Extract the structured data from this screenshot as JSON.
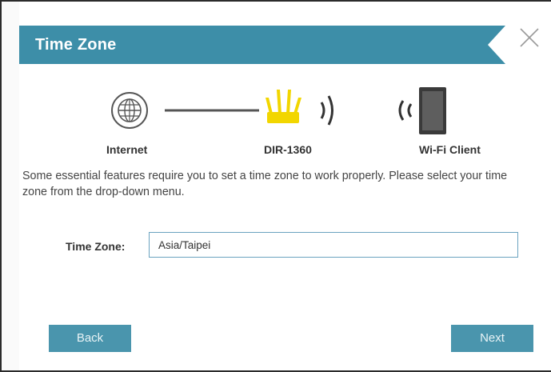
{
  "dialog": {
    "title": "Time Zone",
    "close_icon": "close-x-icon"
  },
  "diagram": {
    "internet_label": "Internet",
    "router_label": "DIR-1360",
    "client_label": "Wi-Fi Client",
    "icons": [
      "globe-icon",
      "router-icon",
      "wifi-signal-icon",
      "tablet-icon"
    ],
    "router_color": "#f2d600"
  },
  "description": "Some essential features require you to set a time zone to work properly. Please select your time zone from the drop-down menu.",
  "time_zone": {
    "label": "Time Zone:",
    "value": "Asia/Taipei"
  },
  "buttons": {
    "back": "Back",
    "next": "Next"
  },
  "colors": {
    "header": "#3d8ea8",
    "button": "#4a95ad",
    "field_border": "#6aa3c0"
  }
}
